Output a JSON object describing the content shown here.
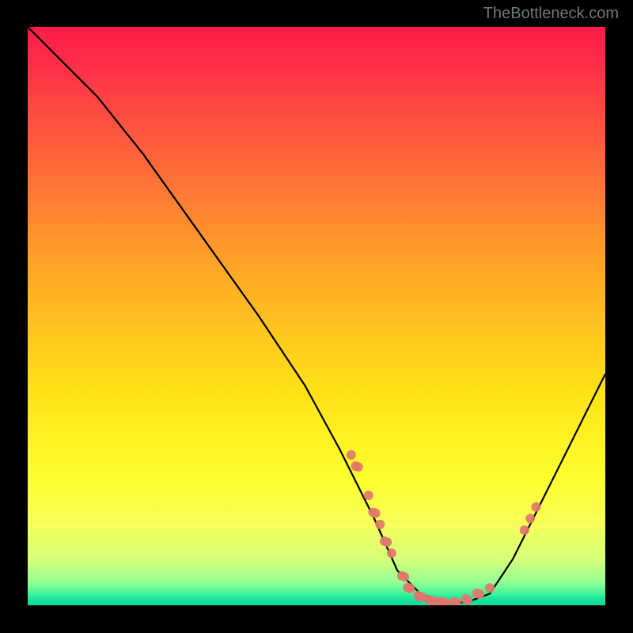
{
  "attribution": "TheBottleneck.com",
  "chart_data": {
    "type": "line",
    "title": "",
    "xlabel": "",
    "ylabel": "",
    "xlim": [
      0,
      100
    ],
    "ylim": [
      0,
      100
    ],
    "gradient_meaning": "background color indicates bottleneck severity: red high, green low",
    "series": [
      {
        "name": "bottleneck-curve",
        "x": [
          0,
          3,
          7,
          12,
          20,
          30,
          40,
          48,
          54,
          60,
          64,
          68,
          72,
          76,
          80,
          84,
          88,
          92,
          96,
          100
        ],
        "y": [
          100,
          97,
          93,
          88,
          78,
          64,
          50,
          38,
          27,
          15,
          6,
          2,
          0.5,
          0.5,
          2,
          8,
          16,
          24,
          32,
          40
        ]
      }
    ],
    "markers": [
      {
        "x": 56,
        "y": 26,
        "count": 1
      },
      {
        "x": 57,
        "y": 24,
        "count": 2
      },
      {
        "x": 59,
        "y": 19,
        "count": 1
      },
      {
        "x": 60,
        "y": 16,
        "count": 2
      },
      {
        "x": 61,
        "y": 14,
        "count": 1
      },
      {
        "x": 62,
        "y": 11,
        "count": 2
      },
      {
        "x": 63,
        "y": 9,
        "count": 1
      },
      {
        "x": 65,
        "y": 5,
        "count": 2
      },
      {
        "x": 66,
        "y": 3,
        "count": 2
      },
      {
        "x": 68,
        "y": 1.5,
        "count": 3
      },
      {
        "x": 70,
        "y": 0.8,
        "count": 3
      },
      {
        "x": 72,
        "y": 0.5,
        "count": 3
      },
      {
        "x": 74,
        "y": 0.5,
        "count": 2
      },
      {
        "x": 76,
        "y": 1,
        "count": 2
      },
      {
        "x": 78,
        "y": 2,
        "count": 2
      },
      {
        "x": 80,
        "y": 3,
        "count": 1
      },
      {
        "x": 86,
        "y": 13,
        "count": 1
      },
      {
        "x": 87,
        "y": 15,
        "count": 1
      },
      {
        "x": 88,
        "y": 17,
        "count": 1
      }
    ],
    "marker_color": "#e2776c"
  }
}
